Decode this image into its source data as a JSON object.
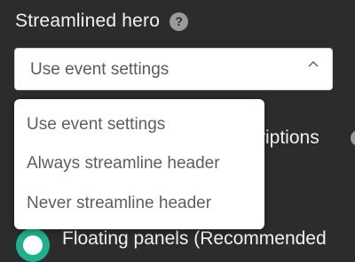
{
  "field": {
    "title": "Streamlined hero",
    "help_icon": "question-circle-icon",
    "selected_value": "Use event settings",
    "expand_icon": "chevron-up-icon"
  },
  "dropdown": {
    "options": [
      {
        "label": "Use event settings"
      },
      {
        "label": "Always streamline header"
      },
      {
        "label": "Never streamline header"
      }
    ]
  },
  "background": {
    "partial_label": "riptions",
    "radio_label": "Floating panels (Recommended",
    "radio_selected": true
  },
  "colors": {
    "page_bg": "#2c2c2c",
    "accent": "#1fb08d",
    "select_bg": "#ffffff"
  }
}
